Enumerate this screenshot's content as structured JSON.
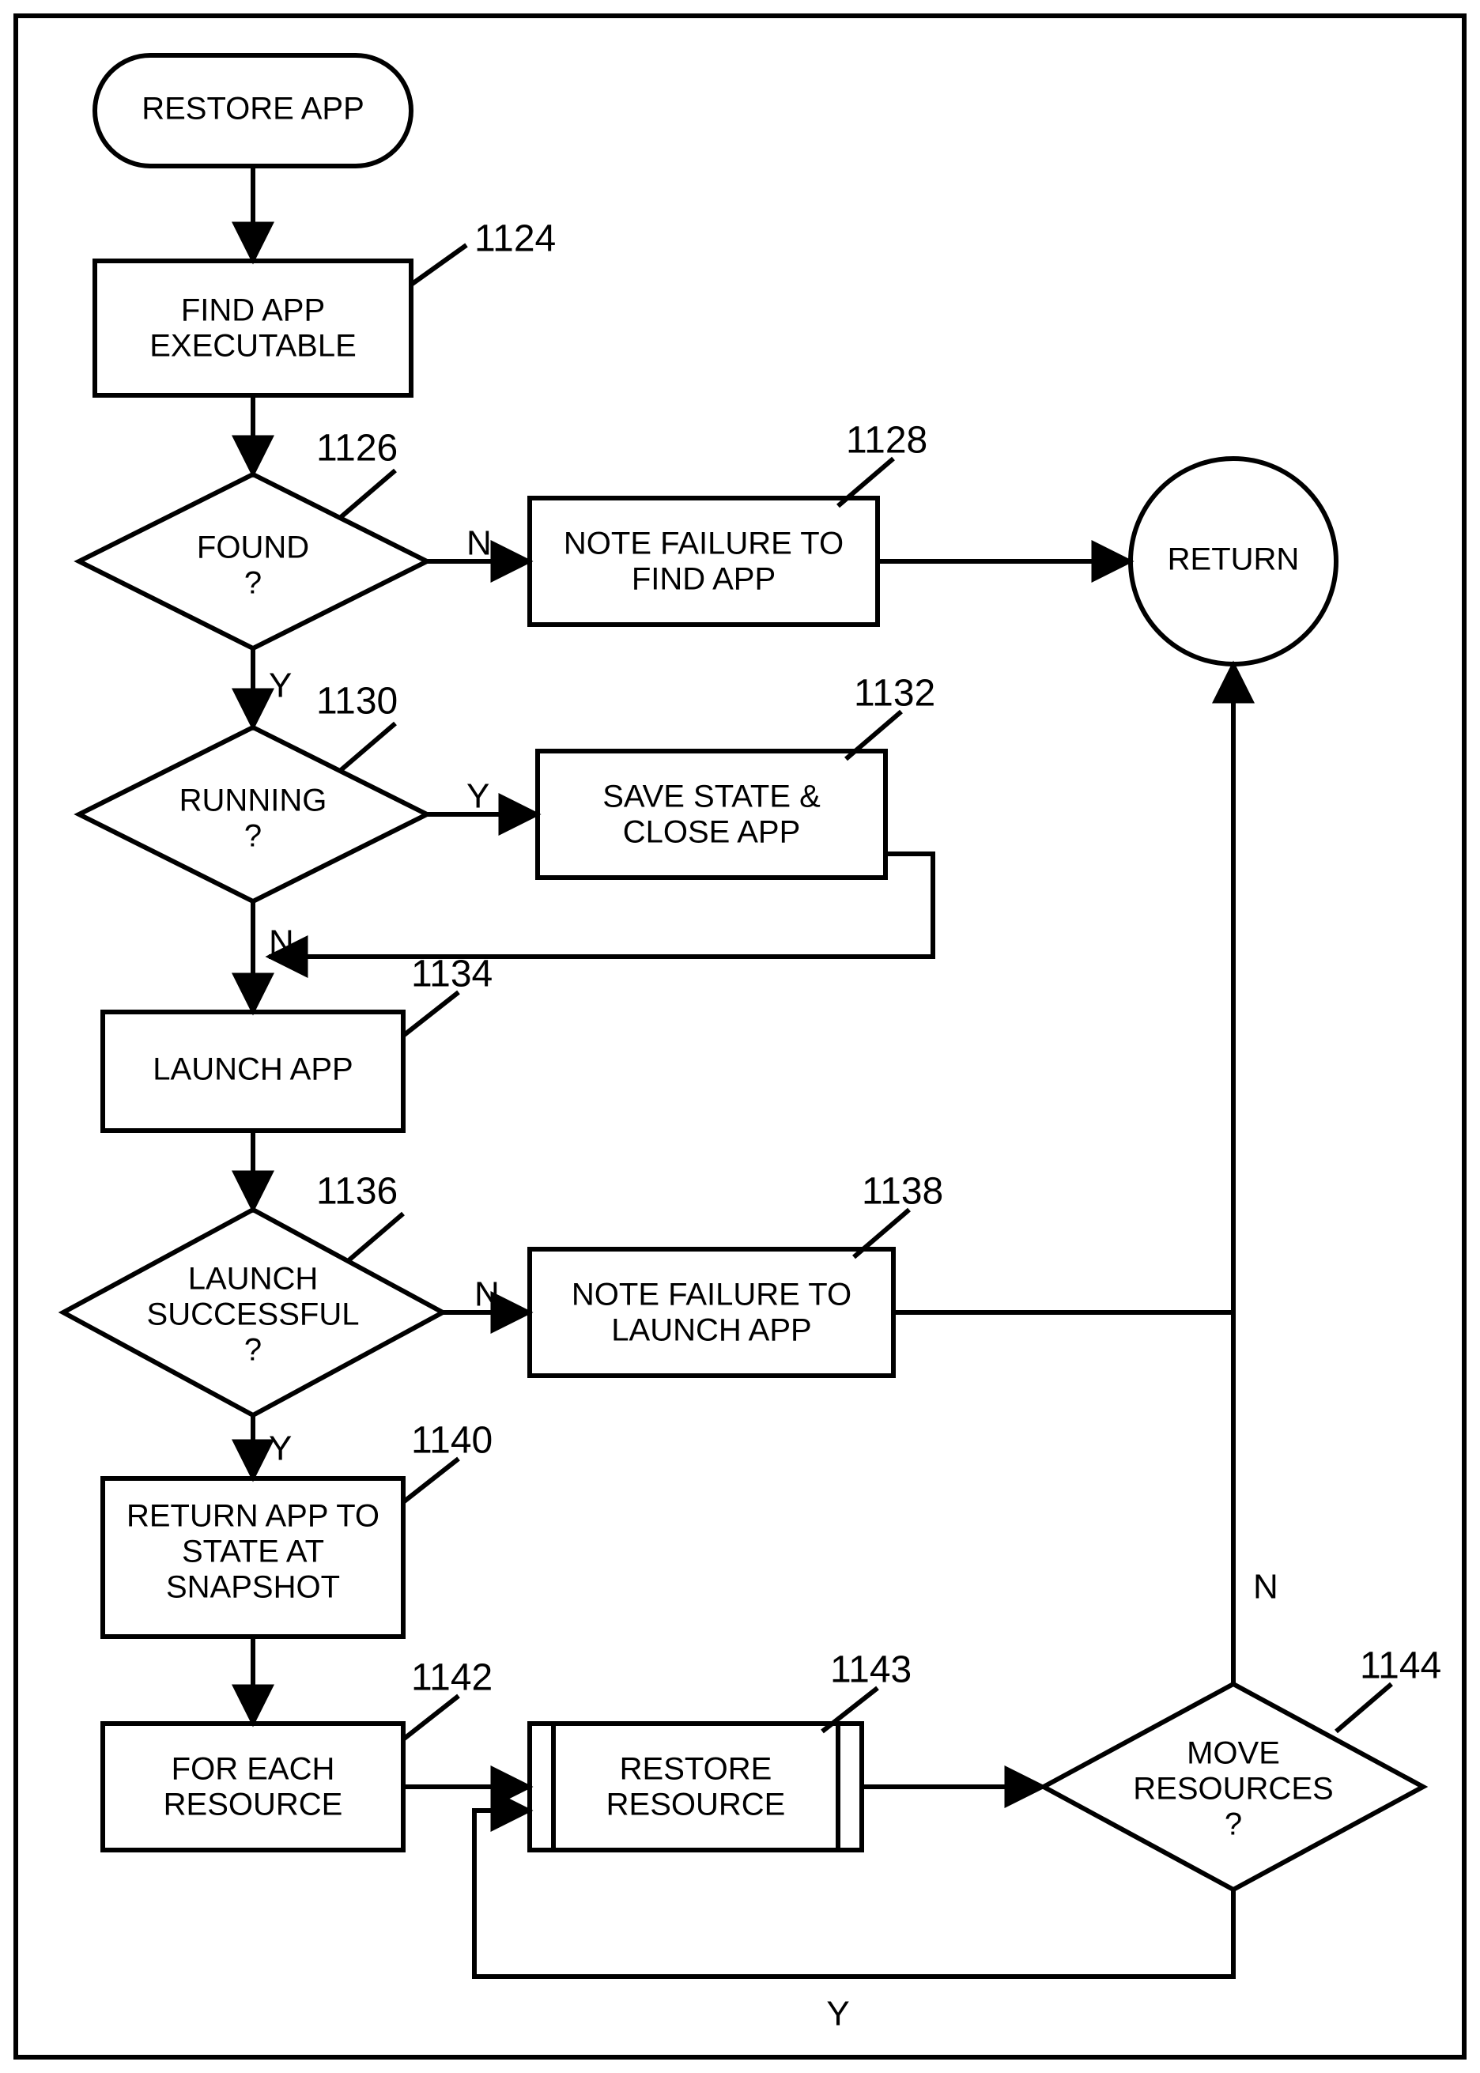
{
  "chart_data": {
    "type": "flowchart",
    "title": "RESTORE APP",
    "nodes": [
      {
        "id": "start",
        "kind": "terminator",
        "text": [
          "RESTORE APP"
        ]
      },
      {
        "id": "n1124",
        "kind": "process",
        "ref": "1124",
        "text": [
          "FIND APP",
          "EXECUTABLE"
        ]
      },
      {
        "id": "n1126",
        "kind": "decision",
        "ref": "1126",
        "text": [
          "FOUND",
          "?"
        ]
      },
      {
        "id": "n1128",
        "kind": "process",
        "ref": "1128",
        "text": [
          "NOTE FAILURE TO",
          "FIND APP"
        ]
      },
      {
        "id": "n1130",
        "kind": "decision",
        "ref": "1130",
        "text": [
          "RUNNING",
          "?"
        ]
      },
      {
        "id": "n1132",
        "kind": "process",
        "ref": "1132",
        "text": [
          "SAVE STATE &",
          "CLOSE APP"
        ]
      },
      {
        "id": "n1134",
        "kind": "process",
        "ref": "1134",
        "text": [
          "LAUNCH APP"
        ]
      },
      {
        "id": "n1136",
        "kind": "decision",
        "ref": "1136",
        "text": [
          "LAUNCH",
          "SUCCESSFUL",
          "?"
        ]
      },
      {
        "id": "n1138",
        "kind": "process",
        "ref": "1138",
        "text": [
          "NOTE FAILURE TO",
          "LAUNCH APP"
        ]
      },
      {
        "id": "n1140",
        "kind": "process",
        "ref": "1140",
        "text": [
          "RETURN APP TO",
          "STATE AT",
          "SNAPSHOT"
        ]
      },
      {
        "id": "n1142",
        "kind": "process",
        "ref": "1142",
        "text": [
          "FOR EACH",
          "RESOURCE"
        ]
      },
      {
        "id": "n1143",
        "kind": "subprocess",
        "ref": "1143",
        "text": [
          "RESTORE",
          "RESOURCE"
        ]
      },
      {
        "id": "n1144",
        "kind": "decision",
        "ref": "1144",
        "text": [
          "MOVE",
          "RESOURCES",
          "?"
        ]
      },
      {
        "id": "return",
        "kind": "connector",
        "text": [
          "RETURN"
        ]
      }
    ],
    "edges": [
      {
        "from": "start",
        "to": "n1124"
      },
      {
        "from": "n1124",
        "to": "n1126"
      },
      {
        "from": "n1126",
        "to": "n1128",
        "label": "N"
      },
      {
        "from": "n1126",
        "to": "n1130",
        "label": "Y"
      },
      {
        "from": "n1128",
        "to": "return"
      },
      {
        "from": "n1130",
        "to": "n1132",
        "label": "Y"
      },
      {
        "from": "n1130",
        "to": "n1134",
        "label": "N"
      },
      {
        "from": "n1132",
        "to": "n1134"
      },
      {
        "from": "n1134",
        "to": "n1136"
      },
      {
        "from": "n1136",
        "to": "n1138",
        "label": "N"
      },
      {
        "from": "n1136",
        "to": "n1140",
        "label": "Y"
      },
      {
        "from": "n1138",
        "to": "return"
      },
      {
        "from": "n1140",
        "to": "n1142"
      },
      {
        "from": "n1142",
        "to": "n1143"
      },
      {
        "from": "n1143",
        "to": "n1144"
      },
      {
        "from": "n1144",
        "to": "return",
        "label": "N"
      },
      {
        "from": "n1144",
        "to": "n1143",
        "label": "Y"
      }
    ]
  },
  "labels": {
    "Y": "Y",
    "N": "N"
  },
  "nodes": {
    "start": {
      "l1": "RESTORE APP"
    },
    "n1124": {
      "ref": "1124",
      "l1": "FIND APP",
      "l2": "EXECUTABLE"
    },
    "n1126": {
      "ref": "1126",
      "l1": "FOUND",
      "l2": "?"
    },
    "n1128": {
      "ref": "1128",
      "l1": "NOTE FAILURE TO",
      "l2": "FIND APP"
    },
    "n1130": {
      "ref": "1130",
      "l1": "RUNNING",
      "l2": "?"
    },
    "n1132": {
      "ref": "1132",
      "l1": "SAVE STATE &",
      "l2": "CLOSE APP"
    },
    "n1134": {
      "ref": "1134",
      "l1": "LAUNCH APP"
    },
    "n1136": {
      "ref": "1136",
      "l1": "LAUNCH",
      "l2": "SUCCESSFUL",
      "l3": "?"
    },
    "n1138": {
      "ref": "1138",
      "l1": "NOTE FAILURE TO",
      "l2": "LAUNCH APP"
    },
    "n1140": {
      "ref": "1140",
      "l1": "RETURN APP TO",
      "l2": "STATE AT",
      "l3": "SNAPSHOT"
    },
    "n1142": {
      "ref": "1142",
      "l1": "FOR EACH",
      "l2": "RESOURCE"
    },
    "n1143": {
      "ref": "1143",
      "l1": "RESTORE",
      "l2": "RESOURCE"
    },
    "n1144": {
      "ref": "1144",
      "l1": "MOVE",
      "l2": "RESOURCES",
      "l3": "?"
    },
    "return": {
      "l1": "RETURN"
    }
  }
}
